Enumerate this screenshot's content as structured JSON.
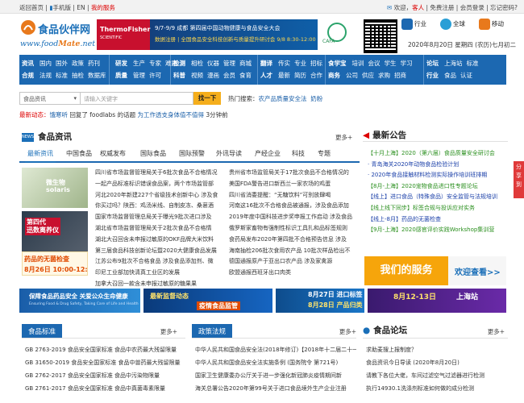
{
  "topbar": {
    "back_home": "返回首页",
    "mobile": "手机版",
    "sep": "|",
    "en": "EN",
    "my_service": "我的服务",
    "welcome": "欢迎，",
    "guest": "客人",
    "register": "免费注册",
    "login": "会员登录",
    "forgot": "忘记密码?"
  },
  "logo": {
    "name": "食品伙伴网",
    "url_prefix": "www.food",
    "url_mid": "Mate",
    "url_suffix": ".net"
  },
  "banner": {
    "brand_line1": "ThermoFisher",
    "brand_line2": "SCIENTIFIC",
    "line1": "9/7-9/9 成都 第四届中国动物健康与食品安全大会",
    "line2": "数据注册 | 全国食品安全科技创新与质量提升研讨会 9/8 8:30-12:00"
  },
  "cafa": "CAFA",
  "apps": {
    "industry": "行业",
    "global": "全球",
    "mobile": "移动"
  },
  "date_text": "2020年8月20日 星期四 (农历)七月初二",
  "nav": [
    {
      "rows": [
        [
          "资讯",
          "国内",
          "国外",
          "政策",
          "药刊"
        ],
        [
          "合规",
          "法规",
          "标准",
          "抽检",
          "数据库"
        ]
      ]
    },
    {
      "rows": [
        [
          "研发",
          "生产",
          "专家",
          "难题"
        ],
        [
          "质量",
          "管理",
          "许可"
        ]
      ]
    },
    {
      "rows": [
        [
          "检测",
          "相检",
          "仪器",
          "管理",
          "商城"
        ],
        [
          "科普",
          "视频",
          "漫画",
          "会员",
          "食育"
        ]
      ]
    },
    {
      "rows": [
        [
          "翻译",
          "传实",
          "专业",
          "招标"
        ],
        [
          "人才",
          "最新",
          "简历",
          "合作"
        ]
      ]
    },
    {
      "rows": [
        [
          "食学宝",
          "培训",
          "会议",
          "学生",
          "学习"
        ],
        [
          "商务",
          "公司",
          "供应",
          "求购",
          "招商"
        ]
      ]
    },
    {
      "rows": [
        [
          "论坛",
          "上海站",
          "标准"
        ],
        [
          "行业",
          "食品",
          "认证"
        ]
      ]
    }
  ],
  "search": {
    "select_value": "食品资讯",
    "placeholder": "请输入关键字",
    "button": "找一下",
    "hot_label": "热门搜索：",
    "hot_keyword_1": "农产品质量安全法",
    "hot_keyword_2": "奶粉"
  },
  "ticker": {
    "label": "最新动态：",
    "user": "饿寒听",
    "text1": " 回复了 foodlabs 的话题 ",
    "topic": "为工作透支身体值不值得",
    "time": " 3分钟前"
  },
  "news": {
    "badge": "NEWS",
    "title": "食品资讯",
    "more": "更多+",
    "tabs": [
      "最新资讯",
      "中国食品",
      "权威发布",
      "国际食品",
      "国际预警",
      "外讯导读",
      "产经企业",
      "科技",
      "专题"
    ],
    "thumbs": [
      {
        "caption": "四川省市场监督管理局关于6批次食品不合格情况",
        "img_text": "微生物\nsolaris"
      },
      {
        "caption": "",
        "img_text": "第四代\n迅数离养仪"
      },
      {
        "caption": "药品的无菌检查",
        "img_text": "药品的无菌检查\n8月26日 10:00-12:00"
      }
    ],
    "col1": [
      "四川省市场监督管理局关于6批次食品不合格情况",
      "一起产品标准标识错误食品案，两个市场监管部",
      "河北2020年新建227个省级技术创新中心 涉及食",
      "你买过吗？陕西：鸡汤米线、自制皮冻、桑葚酒",
      "国家市场监督管理总局关于曝光9批次进口涉及",
      "湖北省市场监督管理局关于2批次食品不合格情",
      "湖北大召回含未申报过敏原的OKF品牌大米饮料",
      "第三届食品科技创新论坛暨2020大健康食品发展",
      "江苏公布9批次不合格食品 涉及食品添加剂、微",
      "印尼工业部加快清真工业区的发展",
      "加拿大召回一款含未申报过敏原的糖果果"
    ],
    "col2": [
      "贵州省市场监管局关于17批次食品不合格情况的",
      "美国FDA警告进口新西兰一家农场的鸡蛋",
      "四川省消委提醒：“无糖饮料”可别放肆喝",
      "河南这16批次不合格食品被通报，涉及食品添加",
      "2019年度中国科技进步奖申报工作启动 涉及食品",
      "俄罗斯家畜物有强制性标识工具扎和品标签规则",
      "食药局发布2020年第四批不合格预告信息 涉及",
      "海南抽检206批次食用农产品 10批次样品检出不",
      "德国通报原产于亚出口农产品 涉及家禽源",
      "欧盟通报西班牙出口肉类",
      ""
    ]
  },
  "ads": [
    {
      "line1": "保障食品药品安全 关爱公众生命健康",
      "line2": "Ensuring Food & Drug Safety, Taking Care of Life and Health"
    },
    {
      "line1": "最新监督动态",
      "line2": "疫情食品监管"
    },
    {
      "line1": "8月27日 进口标签",
      "line2": "8月28日 产品归类"
    },
    {
      "line1": "8月12-13日",
      "line2": "上海站"
    }
  ],
  "standards": {
    "title": "食品标准",
    "more": "更多+",
    "items": [
      "GB 2763-2019 食品安全国家标准 食品中农药最大残留限量",
      "GB 31650-2019 食品安全国家标准 食品中兽药最大残留限量",
      "GB 2762-2017 食品安全国家标准 食品中污染物限量",
      "GB 2761-2017 食品安全国家标准 食品中真菌毒素限量"
    ]
  },
  "regulations": {
    "title": "政策法规",
    "more": "更多+",
    "items": [
      "中华人民共和国食品安全法(2018年修订)【2018年十二届二十一",
      "中华人民共和国食品安全法实施条例 (国务院令 第721号)",
      "国家卫生健康委办公厅关于进一步强化新冠肺炎疫情期间新",
      "海关总署公告2020年第99号关于进口食品境外生产企业注册"
    ]
  },
  "notices": {
    "title": "最新公告",
    "items": [
      {
        "text": "【十月上海】2020（第六届）食品质量安全研讨会",
        "color": "green"
      },
      {
        "text": "· 青岛海关2020年动物食品检验计划",
        "color": "blue"
      },
      {
        "text": "· 2020年食品接触材料检测实际操作培训班排期",
        "color": "blue"
      },
      {
        "text": "【8月-上海】2020宠物食品进口性专题论坛",
        "color": "green"
      },
      {
        "text": "【线上】进口食品（特殊食品）安全监管与法规培训",
        "color": "blue"
      },
      {
        "text": "【线上线下同步】标签合规与投诉应对实务",
        "color": "green"
      },
      {
        "text": "【线上-8月】药品的无菌检查",
        "color": "blue"
      },
      {
        "text": "【9月-上海】2020感官评价实践Workshop集训营",
        "color": "green"
      }
    ],
    "service_button": "我们的服务",
    "service_link": "欢迎查看>>"
  },
  "forum": {
    "title": "食品论坛",
    "more": "更多+",
    "items": [
      "求助麦搜上报制度？",
      "食品资讯今日导读 (2020年8月20日)",
      "请教下各位大佬，车间过滤空气过滤器进行检测",
      "执行14930.1洗涤剂标准如何做的成分检测"
    ]
  },
  "share": "分享到"
}
